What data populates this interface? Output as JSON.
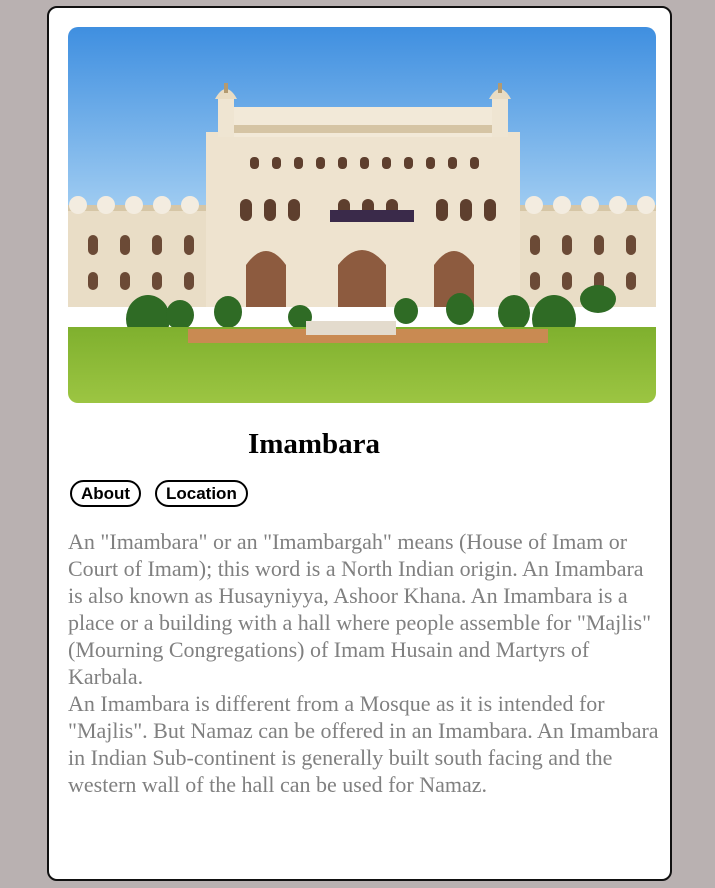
{
  "card": {
    "image_alt": "Bara Imambara, Lucknow",
    "title": "Imambara",
    "buttons": {
      "about": "About",
      "location": "Location"
    },
    "paragraphs": [
      "An \"Imambara\" or an \"Imambargah\" means (House of Imam or Court of Imam); this word is a North Indian origin. An Imambara is also known as Husayniyya, Ashoor Khana. An Imambara is a place or a building with a hall where people assemble for \"Majlis\" (Mourning Congregations) of Imam Husain and Martyrs of Karbala.",
      "An Imambara is different from a Mosque as it is intended for \"Majlis\". But Namaz can be offered in an Imambara. An Imambara in Indian Sub-continent is generally built south facing and the western wall of the hall can be used for Namaz."
    ]
  },
  "colors": {
    "page_background": "#b9b1b1",
    "card_background": "#ffffff",
    "card_border": "#111111",
    "description_text": "#808080",
    "title_text": "#000000"
  }
}
